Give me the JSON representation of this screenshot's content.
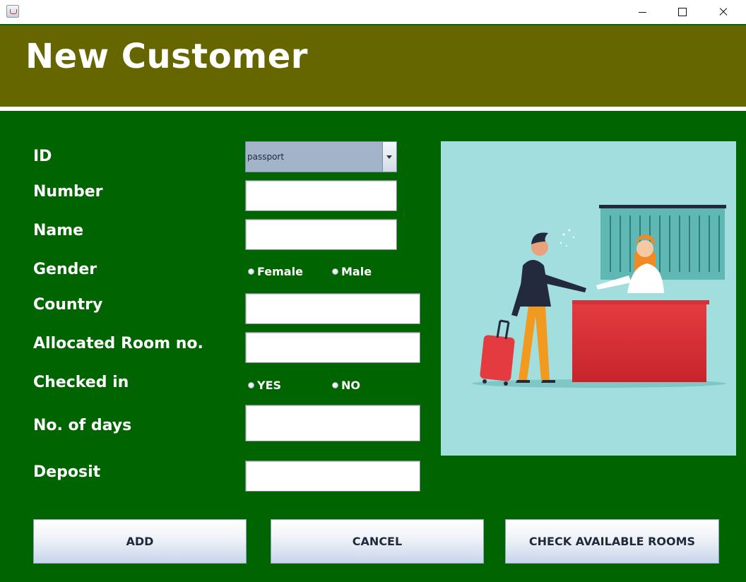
{
  "window": {
    "icon": "java-icon",
    "controls": [
      "minimize-icon",
      "maximize-icon",
      "close-icon"
    ]
  },
  "header": {
    "title": "New Customer"
  },
  "form": {
    "labels": {
      "id": "ID",
      "number": "Number",
      "name": "Name",
      "gender": "Gender",
      "country": "Country",
      "room": "Allocated Room no.",
      "checked_in": "Checked in",
      "days": "No. of days",
      "deposit": "Deposit"
    },
    "id_type": {
      "selected": "passport"
    },
    "values": {
      "number": "",
      "name": "",
      "country": "",
      "room": "",
      "days": "",
      "deposit": ""
    },
    "gender_options": [
      "Female",
      "Male"
    ],
    "checkin_options": [
      "YES",
      "NO"
    ]
  },
  "buttons": {
    "add": "ADD",
    "cancel": "CANCEL",
    "check_rooms": "CHECK AVAILABLE ROOMS"
  },
  "colors": {
    "background": "#006400",
    "header": "#666600",
    "illustration_bg": "#a1dedd",
    "desk": "#e33b3f"
  }
}
